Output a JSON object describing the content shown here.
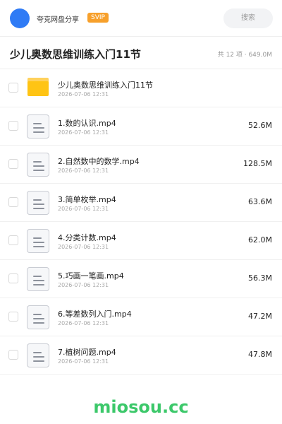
{
  "header": {
    "user_name": "夸克网盘分享",
    "badge": "SVIP",
    "search_label": "搜索"
  },
  "folder": {
    "title": "少儿奥数思维训练入门11节",
    "summary": "共 12 项 · 649.0M"
  },
  "items": [
    {
      "name": "少儿奥数思维训练入门11节",
      "date": "2026-07-06 12:31",
      "size": "",
      "icon": "folder-icon"
    },
    {
      "name": "1.数的认识.mp4",
      "date": "2026-07-06 12:31",
      "size": "52.6M",
      "icon": "file-icon"
    },
    {
      "name": "2.自然数中的数学.mp4",
      "date": "2026-07-06 12:31",
      "size": "128.5M",
      "icon": "file-icon"
    },
    {
      "name": "3.简单枚举.mp4",
      "date": "2026-07-06 12:31",
      "size": "63.6M",
      "icon": "file-icon"
    },
    {
      "name": "4.分类计数.mp4",
      "date": "2026-07-06 12:31",
      "size": "62.0M",
      "icon": "file-icon"
    },
    {
      "name": "5.巧画一笔画.mp4",
      "date": "2026-07-06 12:31",
      "size": "56.3M",
      "icon": "file-icon"
    },
    {
      "name": "6.等差数列入门.mp4",
      "date": "2026-07-06 12:31",
      "size": "47.2M",
      "icon": "file-icon"
    },
    {
      "name": "7.植树问题.mp4",
      "date": "2026-07-06 12:31",
      "size": "47.8M",
      "icon": "file-icon"
    }
  ],
  "watermark": "miosou.cc",
  "colors": {
    "avatar": "#2f7bf5",
    "badge": "#f7a02b",
    "folder": "#ffc414",
    "watermark": "#3cc86a"
  }
}
